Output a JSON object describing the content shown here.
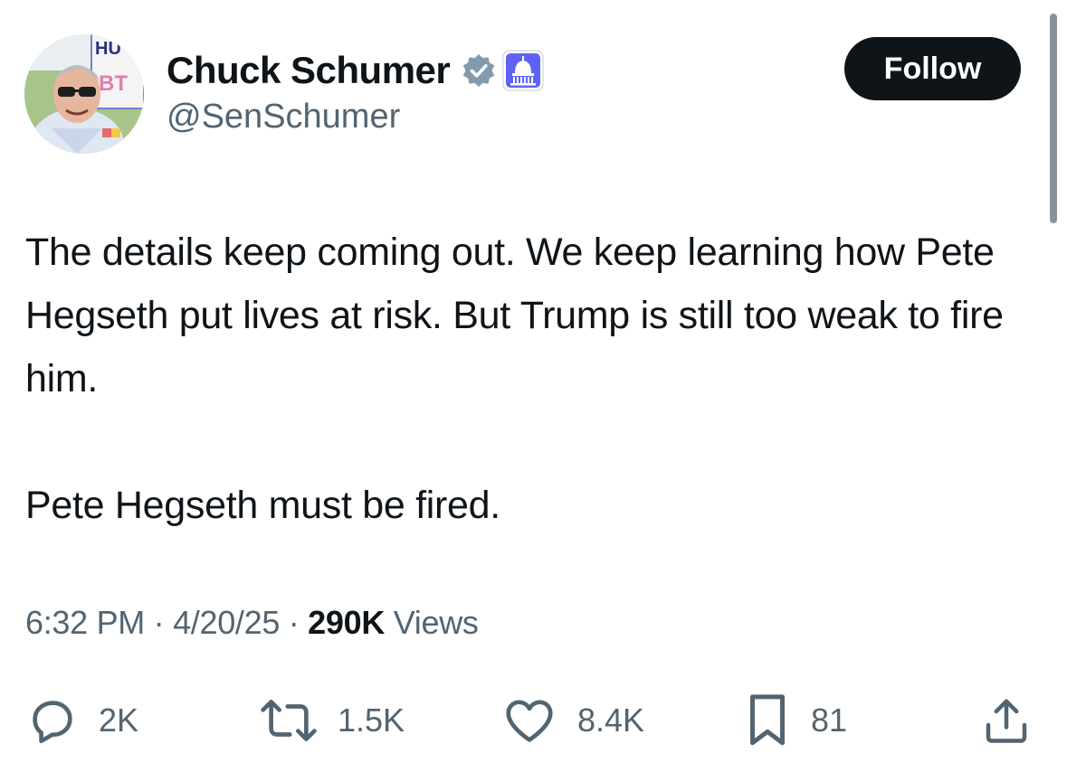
{
  "author": {
    "display_name": "Chuck Schumer",
    "handle": "@SenSchumer",
    "verified_icon": "verified-badge-icon",
    "affiliation_icon": "capitol-building-icon",
    "avatar_sign_text": [
      "HU",
      "BT"
    ]
  },
  "follow_button": {
    "label": "Follow"
  },
  "tweet": {
    "paragraphs": [
      "The details keep coming out. We keep learning how Pete Hegseth put lives at risk. But Trump is still too weak to fire him.",
      "Pete Hegseth must be fired."
    ]
  },
  "meta": {
    "time": "6:32 PM",
    "separator": "·",
    "date": "4/20/25",
    "views_count": "290K",
    "views_label": "Views"
  },
  "actions": {
    "replies": {
      "icon": "reply-icon",
      "count": "2K"
    },
    "reposts": {
      "icon": "repost-icon",
      "count": "1.5K"
    },
    "likes": {
      "icon": "heart-icon",
      "count": "8.4K"
    },
    "bookmarks": {
      "icon": "bookmark-icon",
      "count": "81"
    },
    "share": {
      "icon": "share-icon"
    }
  },
  "colors": {
    "text_primary": "#0f1419",
    "text_secondary": "#536471",
    "verified_badge": "#829aab",
    "affiliation_badge": "#5e63f5",
    "follow_bg": "#0f1419",
    "follow_text": "#ffffff"
  }
}
